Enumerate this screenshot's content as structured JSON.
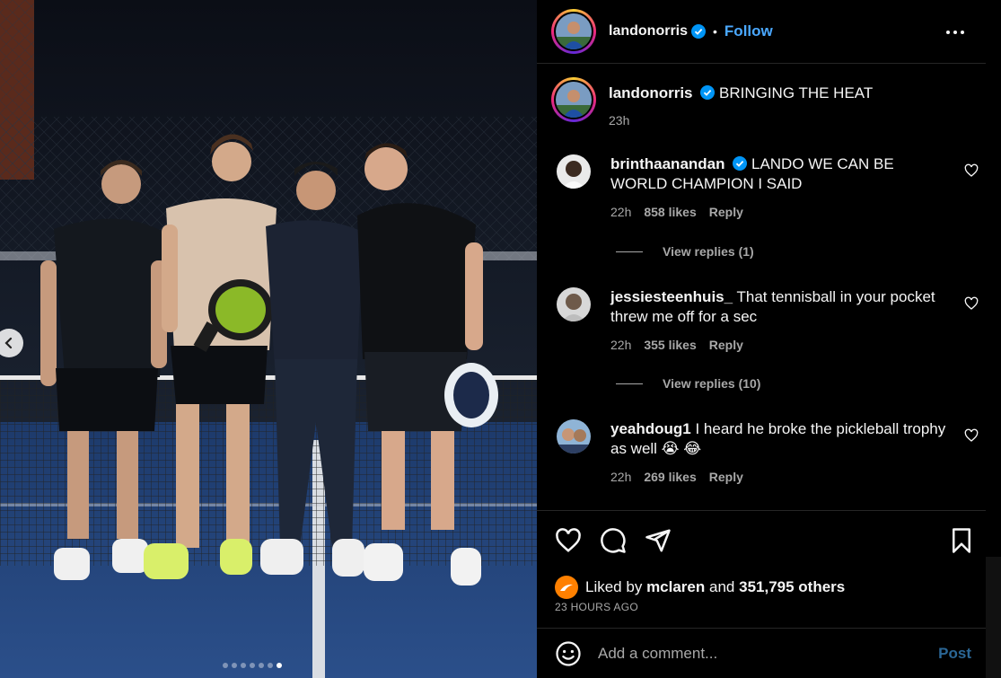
{
  "post": {
    "author": "landonorris",
    "verified": true,
    "follow_label": "Follow",
    "separator": "•",
    "caption": "BRINGING THE HEAT",
    "caption_time": "23h",
    "carousel": {
      "count": 7,
      "active_index": 6
    }
  },
  "comments": [
    {
      "user": "brinthaanandan",
      "verified": true,
      "text": "LANDO WE CAN BE WORLD CHAMPION I SAID",
      "time": "22h",
      "likes": "858 likes",
      "reply_label": "Reply",
      "replies_label": "View replies (1)"
    },
    {
      "user": "jessiesteenhuis_",
      "verified": false,
      "text": "That tennisball in your pocket threw me off for a sec",
      "time": "22h",
      "likes": "355 likes",
      "reply_label": "Reply",
      "replies_label": "View replies (10)"
    },
    {
      "user": "yeahdoug1",
      "verified": false,
      "text": "I heard he broke the pickleball trophy as well 😭 😂",
      "time": "22h",
      "likes": "269 likes",
      "reply_label": "Reply"
    }
  ],
  "likes": {
    "prefix": "Liked by",
    "by_user": "mclaren",
    "middle": "and",
    "others": "351,795 others"
  },
  "timestamp": "23 HOURS AGO",
  "comment_box": {
    "placeholder": "Add a comment...",
    "post_label": "Post"
  },
  "colors": {
    "accent": "#0095f6",
    "mclaren_orange": "#ff8000",
    "court_blue": "#1f3f73"
  },
  "icons": [
    "verified-badge-icon",
    "more-options-icon",
    "heart-icon",
    "comment-icon",
    "share-icon",
    "bookmark-icon",
    "emoji-icon",
    "chevron-left-icon"
  ]
}
